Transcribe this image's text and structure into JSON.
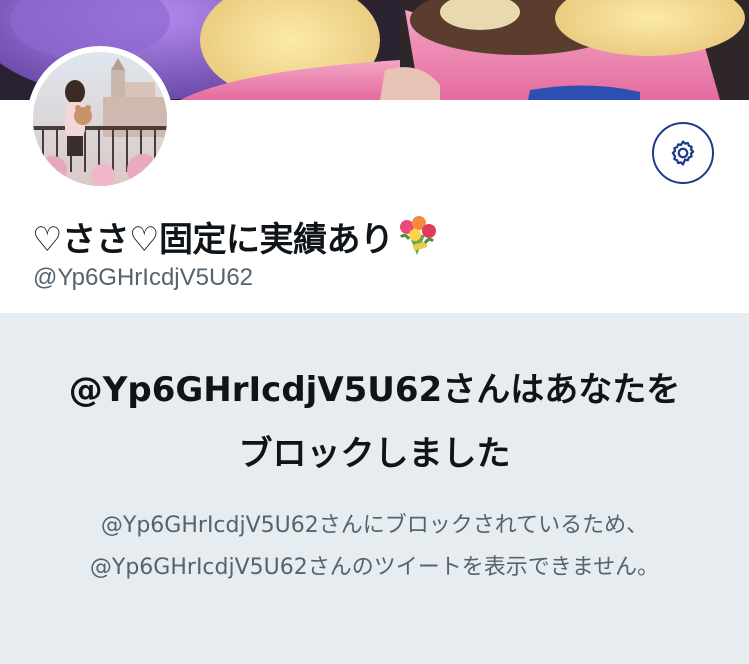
{
  "profile": {
    "display_name": "♡ささ♡固定に実績あり",
    "display_name_emoji": "💐",
    "handle": "@Yp6GHrIcdjV5U62",
    "settings_icon": "gear-icon"
  },
  "blocked": {
    "title": "@Yp6GHrIcdjV5U62さんはあなたをブロックしました",
    "description": "@Yp6GHrIcdjV5U62さんにブロックされているため、@Yp6GHrIcdjV5U62さんのツイートを表示できません。"
  },
  "colors": {
    "accent": "#1e3a8a",
    "text_primary": "#0f1419",
    "text_secondary": "#536471",
    "notice_background": "#e7ecf0"
  }
}
